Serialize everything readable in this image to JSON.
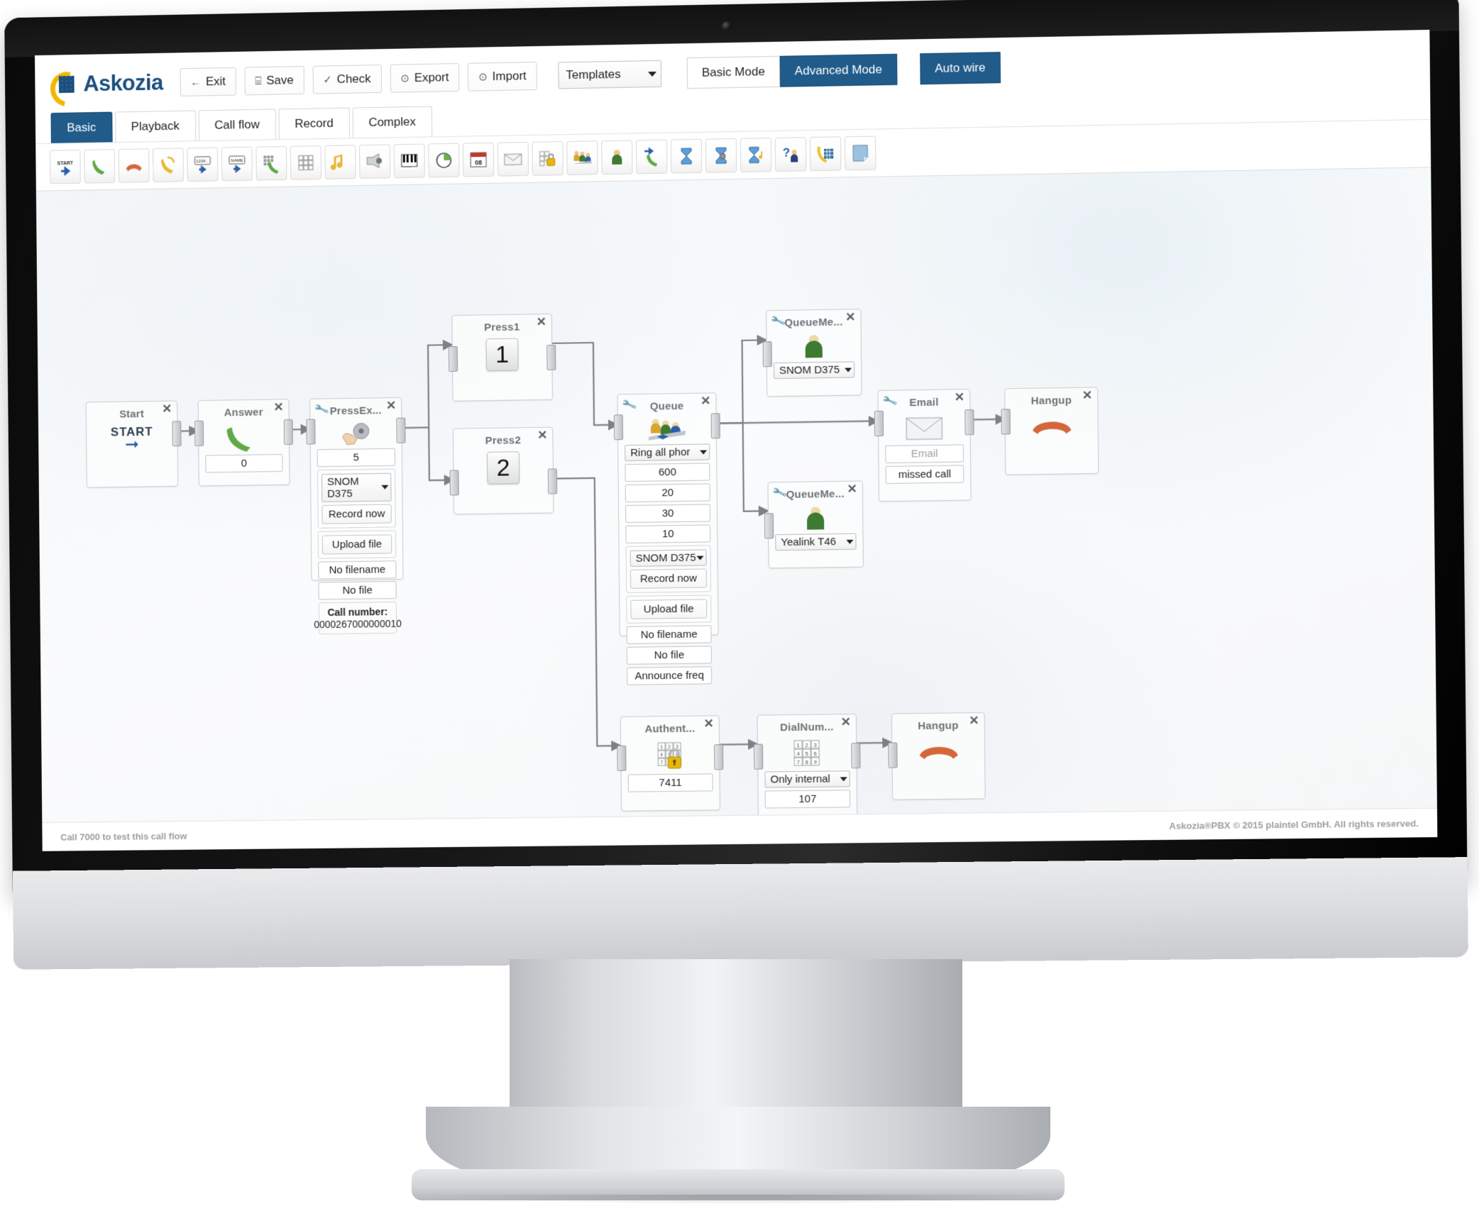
{
  "brand": {
    "name": "Askozia"
  },
  "toolbar": {
    "buttons": [
      {
        "label": "Exit",
        "icon": "arrow-left-icon",
        "glyph": "←"
      },
      {
        "label": "Save",
        "icon": "floppy-disk-icon",
        "glyph": "⌸"
      },
      {
        "label": "Check",
        "icon": "checkmark-icon",
        "glyph": "✓"
      },
      {
        "label": "Export",
        "icon": "download-circle-icon",
        "glyph": "⊙"
      },
      {
        "label": "Import",
        "icon": "upload-circle-icon",
        "glyph": "⊙"
      }
    ],
    "templates_select": {
      "value": "Templates"
    },
    "mode_basic": "Basic Mode",
    "mode_advanced": "Advanced Mode",
    "auto_wire": "Auto wire",
    "active_mode": "Advanced Mode",
    "accent_color": "#205b8a"
  },
  "tabs": [
    {
      "label": "Basic",
      "active": true
    },
    {
      "label": "Playback",
      "active": false
    },
    {
      "label": "Call flow",
      "active": false
    },
    {
      "label": "Record",
      "active": false
    },
    {
      "label": "Complex",
      "active": false
    }
  ],
  "palette": [
    {
      "icon": "start-icon"
    },
    {
      "icon": "answer-handset-icon"
    },
    {
      "icon": "hangup-handset-icon"
    },
    {
      "icon": "transfer-handset-icon"
    },
    {
      "icon": "play-number-icon"
    },
    {
      "icon": "play-name-icon"
    },
    {
      "icon": "dial-handset-icon"
    },
    {
      "icon": "keypad-icon"
    },
    {
      "icon": "music-note-icon"
    },
    {
      "icon": "megaphone-icon"
    },
    {
      "icon": "piano-keys-icon"
    },
    {
      "icon": "pie-timer-icon"
    },
    {
      "icon": "calendar-08-icon"
    },
    {
      "icon": "envelope-icon"
    },
    {
      "icon": "keypad-lock-icon"
    },
    {
      "icon": "queue-people-icon"
    },
    {
      "icon": "queue-member-icon"
    },
    {
      "icon": "goto-handset-icon"
    },
    {
      "icon": "hourglass-icon"
    },
    {
      "icon": "hourglass-gear-icon"
    },
    {
      "icon": "hourglass-music-icon"
    },
    {
      "icon": "question-person-icon"
    },
    {
      "icon": "dialplan-icon"
    },
    {
      "icon": "note-page-icon"
    }
  ],
  "nodes": {
    "start": {
      "title": "Start",
      "label": "START"
    },
    "answer": {
      "title": "Answer",
      "value": "0"
    },
    "pressex": {
      "title": "PressEx...",
      "value": "5",
      "sound_select": "SNOM D375",
      "record_btn": "Record now",
      "upload_btn": "Upload file",
      "filename": "No filename",
      "file": "No file",
      "call_number_label": "Call number:",
      "call_number_value": "0000267000000010"
    },
    "press1": {
      "title": "Press1",
      "key": "1"
    },
    "press2": {
      "title": "Press2",
      "key": "2"
    },
    "queue": {
      "title": "Queue",
      "strategy": "Ring all phor",
      "timeout": "600",
      "retry": "20",
      "wrapup": "30",
      "weight": "10",
      "sound_select": "SNOM D375",
      "record_btn": "Record now",
      "upload_btn": "Upload file",
      "filename": "No filename",
      "file": "No file",
      "announce": "Announce freq"
    },
    "queuemember1": {
      "title": "QueueMe...",
      "device": "SNOM D375"
    },
    "queuemember2": {
      "title": "QueueMe...",
      "device": "Yealink T46"
    },
    "email": {
      "title": "Email",
      "to_placeholder": "Email",
      "subject": "missed call"
    },
    "hangup1": {
      "title": "Hangup"
    },
    "authenticate": {
      "title": "Authent...",
      "pin": "7411"
    },
    "dialnumber": {
      "title": "DialNum...",
      "scope": "Only internal",
      "number": "107"
    },
    "hangup2": {
      "title": "Hangup"
    }
  },
  "footer": {
    "left": "Call 7000 to test this call flow",
    "right": "Askozia®PBX © 2015 plaintel GmbH. All rights reserved."
  }
}
